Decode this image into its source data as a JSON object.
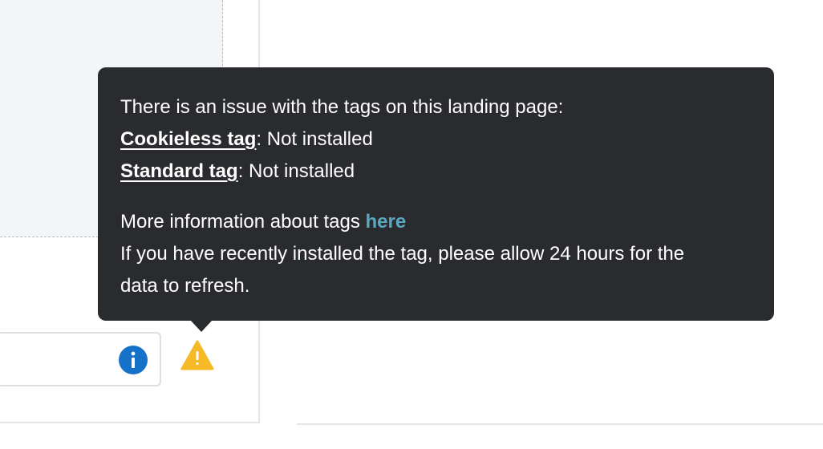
{
  "tooltip": {
    "intro": "There is an issue with the tags on this landing page:",
    "tags": [
      {
        "name": "Cookieless tag",
        "status": ": Not installed"
      },
      {
        "name": "Standard tag",
        "status": ": Not installed"
      }
    ],
    "more_info_text": "More information about tags ",
    "more_info_link": "here",
    "refresh_line1": "If you have recently installed the tag, please allow 24 hours for the",
    "refresh_line2": "data to refresh."
  },
  "icons": {
    "info": "info-icon",
    "warning": "warning-icon"
  },
  "colors": {
    "tooltip_bg": "#2a2b2e",
    "link": "#5aa7c0",
    "info_blue": "#1672c9",
    "warning_yellow": "#f6b928"
  }
}
